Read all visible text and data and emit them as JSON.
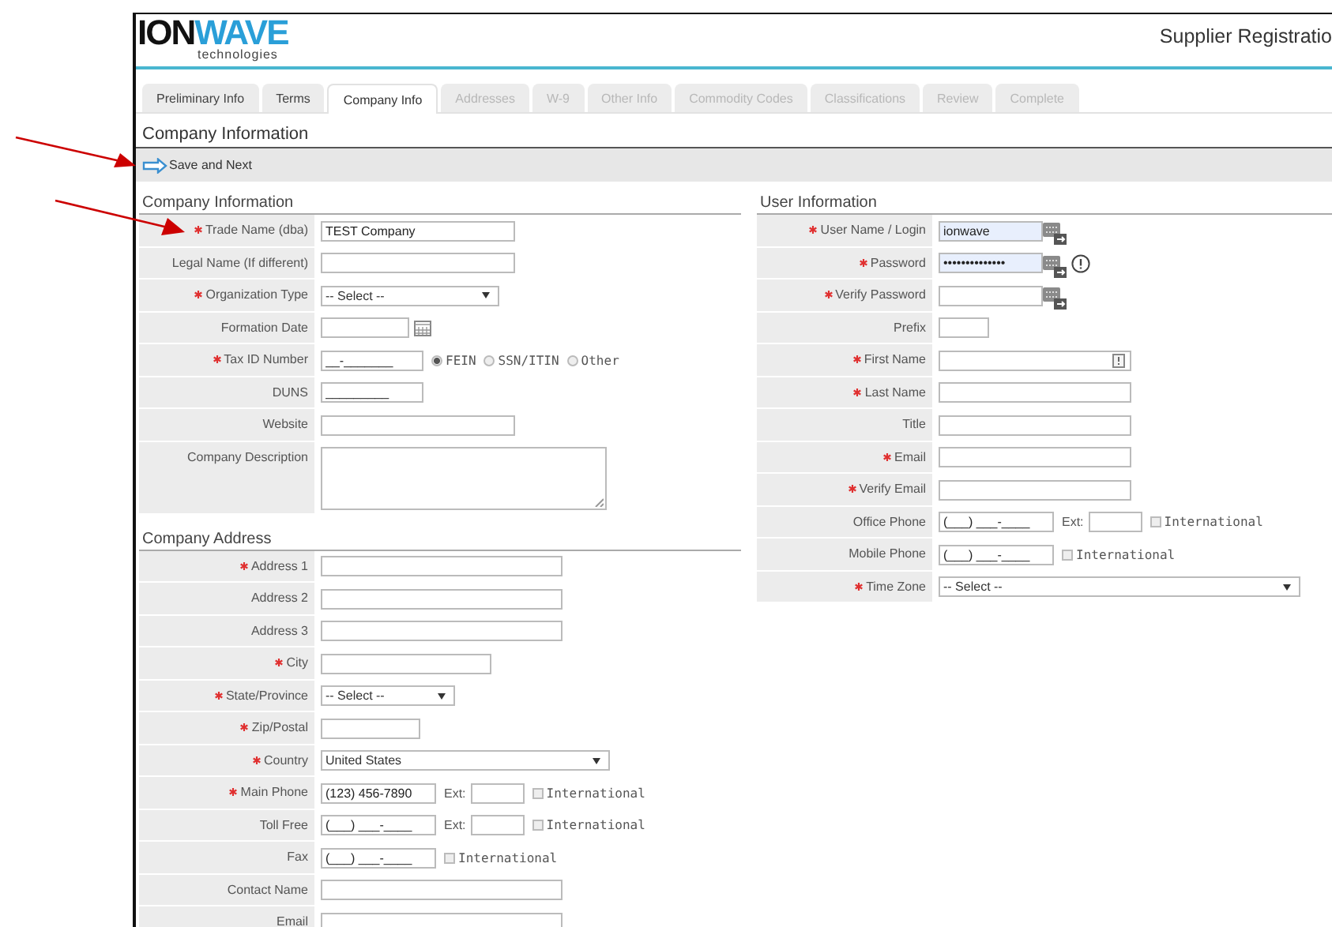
{
  "logo": {
    "part1": "ION",
    "part2": "WAVE",
    "tagline": "technologies"
  },
  "header_title": "Supplier Registratio",
  "tabs": [
    {
      "label": "Preliminary Info",
      "selected": false,
      "disabled": false
    },
    {
      "label": "Terms",
      "selected": false,
      "disabled": false
    },
    {
      "label": "Company Info",
      "selected": true,
      "disabled": false
    },
    {
      "label": "Addresses",
      "selected": false,
      "disabled": true
    },
    {
      "label": "W-9",
      "selected": false,
      "disabled": true
    },
    {
      "label": "Other Info",
      "selected": false,
      "disabled": true
    },
    {
      "label": "Commodity Codes",
      "selected": false,
      "disabled": true
    },
    {
      "label": "Classifications",
      "selected": false,
      "disabled": true
    },
    {
      "label": "Review",
      "selected": false,
      "disabled": true
    },
    {
      "label": "Complete",
      "selected": false,
      "disabled": true
    }
  ],
  "page_title": "Company Information",
  "toolbar": {
    "save_button": "Save and Next"
  },
  "columns": [
    {
      "sections": [
        {
          "title": "Company Information",
          "rows": [
            {
              "label": "Trade Name (dba)",
              "required": true,
              "kind": "text",
              "value": "TEST Company"
            },
            {
              "label": "Legal Name (If different)",
              "required": false,
              "kind": "text"
            },
            {
              "label": "Organization Type",
              "required": true,
              "kind": "select",
              "value": "-- Select --"
            },
            {
              "label": "Formation Date",
              "required": false,
              "kind": "date"
            },
            {
              "label": "Tax ID Number",
              "required": true,
              "kind": "taxid",
              "value": "__-_______",
              "options": [
                {
                  "label": "FEIN",
                  "selected": true
                },
                {
                  "label": "SSN/ITIN",
                  "selected": false
                },
                {
                  "label": "Other",
                  "selected": false
                }
              ]
            },
            {
              "label": "DUNS",
              "required": false,
              "kind": "text",
              "value": "_________"
            },
            {
              "label": "Website",
              "required": false,
              "kind": "text"
            },
            {
              "label": "Company Description",
              "required": false,
              "kind": "textarea"
            }
          ]
        },
        {
          "title": "Company Address",
          "rows": [
            {
              "label": "Address 1",
              "required": true,
              "kind": "text"
            },
            {
              "label": "Address 2",
              "required": false,
              "kind": "text"
            },
            {
              "label": "Address 3",
              "required": false,
              "kind": "text"
            },
            {
              "label": "City",
              "required": true,
              "kind": "text"
            },
            {
              "label": "State/Province",
              "required": true,
              "kind": "select",
              "value": "-- Select --"
            },
            {
              "label": "Zip/Postal",
              "required": true,
              "kind": "text"
            },
            {
              "label": "Country",
              "required": true,
              "kind": "select",
              "value": "United States"
            },
            {
              "label": "Main Phone",
              "required": true,
              "kind": "phone",
              "value": "(123) 456-7890",
              "ext_label": "Ext:",
              "checkbox": {
                "label": "International",
                "checked": false
              }
            },
            {
              "label": "Toll Free",
              "required": false,
              "kind": "phone",
              "value": "(___) ___-____",
              "ext_label": "Ext:",
              "checkbox": {
                "label": "International",
                "checked": false
              }
            },
            {
              "label": "Fax",
              "required": false,
              "kind": "phone",
              "value": "(___) ___-____",
              "checkbox": {
                "label": "International",
                "checked": false
              }
            },
            {
              "label": "Contact Name",
              "required": false,
              "kind": "text"
            },
            {
              "label": "Email",
              "required": false,
              "kind": "text"
            }
          ]
        }
      ]
    },
    {
      "sections": [
        {
          "title": "User Information",
          "rows": [
            {
              "label": "User Name / Login",
              "required": true,
              "kind": "text",
              "value": "ionwave",
              "autofilled": true,
              "keypad_icon": true
            },
            {
              "label": "Password",
              "required": true,
              "kind": "text",
              "value": "••••••••••••••",
              "autofilled": true,
              "keypad_icon": true,
              "info_icon": true
            },
            {
              "label": "Verify Password",
              "required": true,
              "kind": "text",
              "autofilled": false,
              "keypad_icon": true
            },
            {
              "label": "Prefix",
              "required": false,
              "kind": "text"
            },
            {
              "label": "First Name",
              "required": true,
              "kind": "text",
              "inner_icon": true
            },
            {
              "label": "Last Name",
              "required": true,
              "kind": "text"
            },
            {
              "label": "Title",
              "required": false,
              "kind": "text"
            },
            {
              "label": "Email",
              "required": true,
              "kind": "text"
            },
            {
              "label": "Verify Email",
              "required": true,
              "kind": "text"
            },
            {
              "label": "Office Phone",
              "required": false,
              "kind": "phone",
              "value": "(___) ___-____",
              "ext_label": "Ext:",
              "checkbox": {
                "label": "International",
                "checked": false
              }
            },
            {
              "label": "Mobile Phone",
              "required": false,
              "kind": "phone",
              "value": "(___) ___-____",
              "checkbox": {
                "label": "International",
                "checked": false
              }
            },
            {
              "label": "Time Zone",
              "required": true,
              "kind": "select",
              "value": "-- Select --"
            }
          ]
        }
      ]
    }
  ]
}
